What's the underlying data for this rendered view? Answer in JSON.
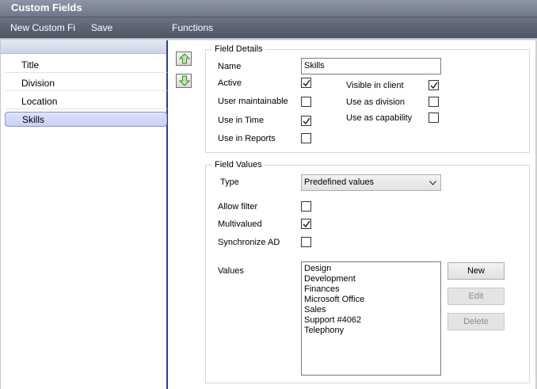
{
  "window": {
    "title": "Custom Fields"
  },
  "menu": {
    "new_label": "New Custom Fi",
    "save_label": "Save",
    "functions_label": "Functions"
  },
  "sidebar": {
    "items": [
      {
        "label": "Title"
      },
      {
        "label": "Division"
      },
      {
        "label": "Location"
      },
      {
        "label": "Skills",
        "selected": true
      }
    ]
  },
  "reorder": {
    "up_icon": "arrow-up-icon",
    "down_icon": "arrow-down-icon",
    "color": "#4caf2c"
  },
  "field_details": {
    "title": "Field Details",
    "name_label": "Name",
    "name_value": "Skills",
    "active_label": "Active",
    "active_checked": true,
    "user_maintainable_label": "User maintainable",
    "user_maintainable_checked": false,
    "use_in_time_label": "Use in Time",
    "use_in_time_checked": true,
    "use_in_reports_label": "Use in Reports",
    "use_in_reports_checked": false,
    "visible_in_client_label": "Visible in client",
    "visible_in_client_checked": true,
    "use_as_division_label": "Use as division",
    "use_as_division_checked": false,
    "use_as_capability_label": "Use as capability",
    "use_as_capability_checked": false
  },
  "field_values": {
    "title": "Field Values",
    "type_label": "Type",
    "type_value": "Predefined values",
    "allow_filter_label": "Allow filter",
    "allow_filter_checked": false,
    "multivalued_label": "Multivalued",
    "multivalued_checked": true,
    "sync_ad_label": "Synchronize AD",
    "sync_ad_checked": false,
    "values_label": "Values",
    "values": [
      "Design",
      "Development",
      "Finances",
      "Microsoft Office",
      "Sales",
      "Support #4062",
      "Telephony"
    ],
    "new_button": "New",
    "edit_button": "Edit",
    "delete_button": "Delete"
  }
}
